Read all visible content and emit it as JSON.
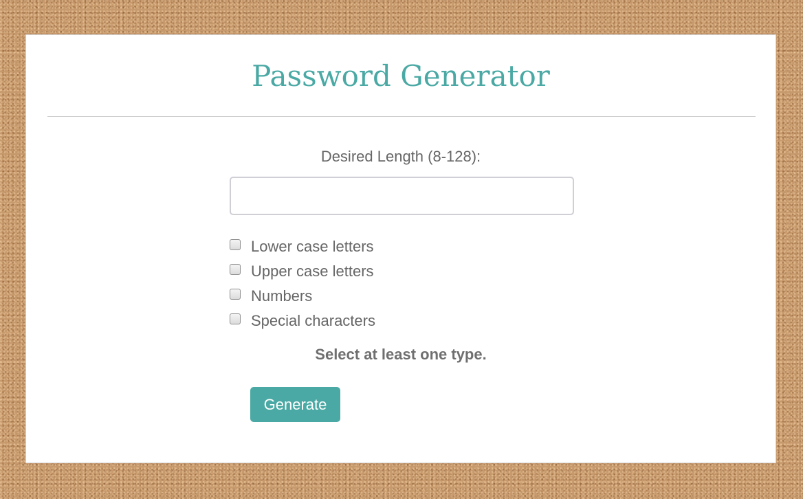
{
  "app": {
    "title": "Password Generator"
  },
  "form": {
    "length_label": "Desired Length (8-128):",
    "length_value": "",
    "length_placeholder": "",
    "options": [
      {
        "label": "Lower case letters",
        "checked": false
      },
      {
        "label": "Upper case letters",
        "checked": false
      },
      {
        "label": "Numbers",
        "checked": false
      },
      {
        "label": "Special characters",
        "checked": false
      }
    ],
    "message": "Select at least one type.",
    "generate_label": "Generate"
  },
  "colors": {
    "accent": "#4aa9a4",
    "text": "#666666",
    "card_background": "#ffffff",
    "page_background": "#c79a6d"
  }
}
